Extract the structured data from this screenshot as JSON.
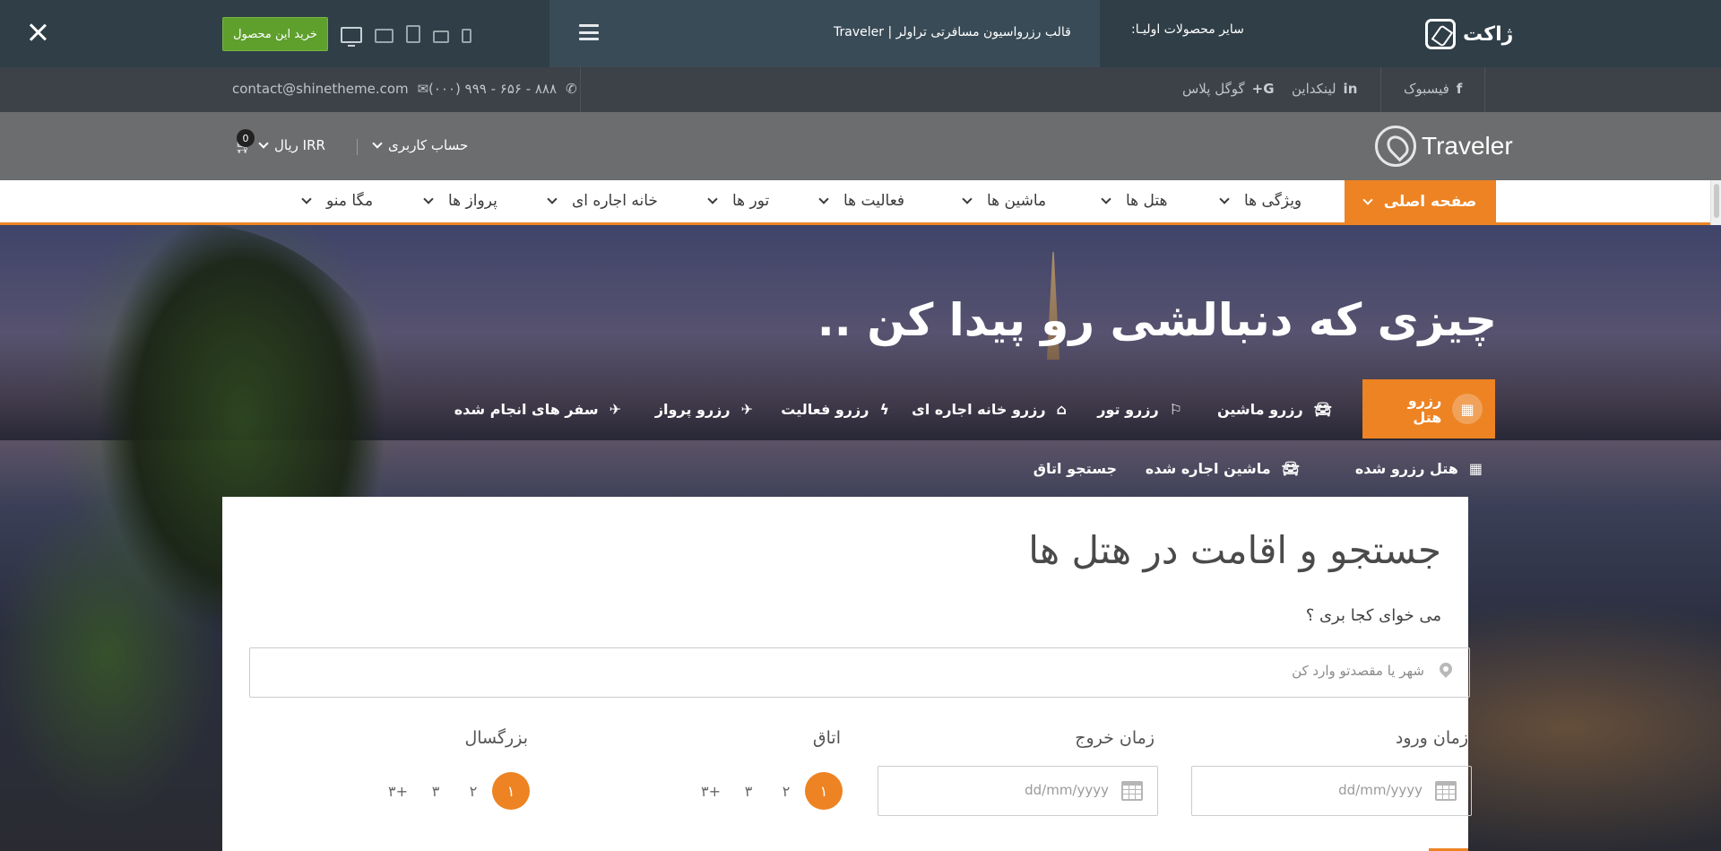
{
  "demo_bar": {
    "logo_text": "ژاکت",
    "other_products": "سایر محصولات اولیـا:",
    "page_title": "قالب رزرواسیون مسافرتی تراولر | Traveler",
    "buy_button": "خرید این محصول",
    "devices": [
      "desktop-icon",
      "laptop-icon",
      "tablet-icon",
      "tablet-landscape-icon",
      "mobile-icon"
    ]
  },
  "social_bar": {
    "facebook": "فیسبوک",
    "linkedin": "لینکداین",
    "googleplus": "گوگل پلاس",
    "phone": "(۰۰۰) ۹۹۹ - ۶۵۶ - ۸۸۸",
    "email": "contact@shinetheme.com"
  },
  "header": {
    "brand": "Traveler",
    "account": "حساب کاربری",
    "currency": "IRR ریال",
    "cart_count": "0"
  },
  "nav": {
    "home": "صفحه اصلی",
    "items": [
      "ویژگی ها",
      "هتل ها",
      "ماشین ها",
      "فعالیت ها",
      "تور ها",
      "خانه اجاره ای",
      "پرواز ها",
      "مگا منو"
    ]
  },
  "hero": {
    "title": "چیزی که دنبالشی رو پیدا کن ..",
    "tabs_row1": [
      "رزرو هتل",
      "رزرو ماشین",
      "رزرو تور",
      "رزرو خانه اجاره ای",
      "رزرو فعالیت",
      "رزرو پرواز",
      "سفر های انجام شده"
    ],
    "tabs_row2": [
      "هتل رزرو شده",
      "ماشین اجاره شده",
      "جستجو اتاق"
    ]
  },
  "search": {
    "title": "جستجو و اقامت در هتل ها",
    "question": "می خوای کجا بری ؟",
    "destination_placeholder": "شهر یا مقصدتو وارد کن",
    "checkin_label": "زمان ورود",
    "checkout_label": "زمان خروج",
    "rooms_label": "اتاق",
    "adults_label": "بزرگسال",
    "date_placeholder": "dd/mm/yyyy",
    "room_options": [
      "۱",
      "۲",
      "۳",
      "+۳"
    ],
    "adult_options": [
      "۱",
      "۲",
      "۳",
      "+۳"
    ]
  },
  "colors": {
    "accent": "#ed8323",
    "buy_green": "#5fa02d",
    "demo_bar": "#2f3e47"
  }
}
